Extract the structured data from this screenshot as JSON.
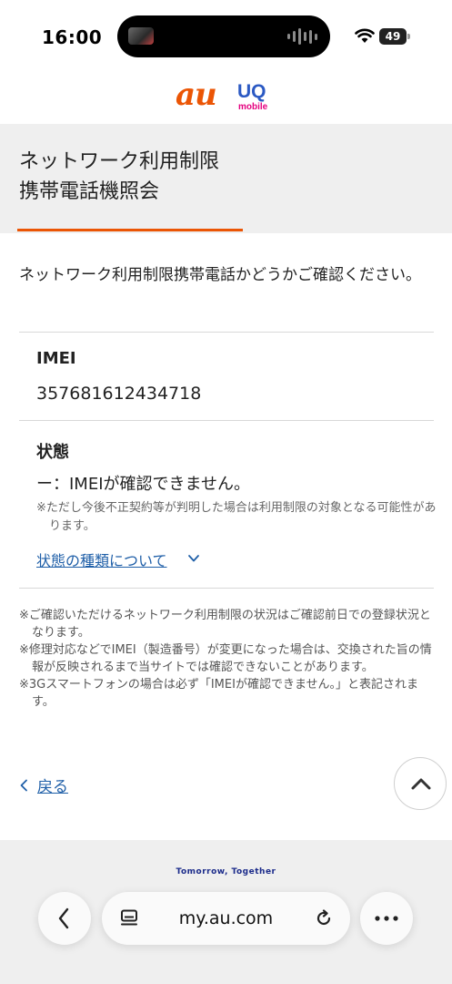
{
  "status_bar": {
    "time": "16:00",
    "battery": "49"
  },
  "logos": {
    "au": "au",
    "uq": "UQ",
    "uq_sub": "mobile"
  },
  "page_title": "ネットワーク利用制限\n携帯電話機照会",
  "intro": "ネットワーク利用制限携帯電話かどうかご確認ください。",
  "imei": {
    "label": "IMEI",
    "value": "357681612434718"
  },
  "status": {
    "label": "状態",
    "value": "ー：IMEIが確認できません。",
    "note": "※ただし今後不正契約等が判明した場合は利用制限の対象となる可能性があります。",
    "link": "状態の種類について"
  },
  "footnotes": [
    "※ご確認いただけるネットワーク利用制限の状況はご確認前日での登録状況となります。",
    "※修理対応などでIMEI（製造番号）が変更になった場合は、交換された旨の情報が反映されるまで当サイトでは確認できないことがあります。",
    "※3Gスマートフォンの場合は必ず「IMEIが確認できません。」と表記されます。"
  ],
  "back_link": "戻る",
  "footer_tagline": "Tomorrow, Together",
  "browser": {
    "url": "my.au.com"
  },
  "colors": {
    "accent": "#eb5505",
    "link": "#1f5fa8",
    "band": "#efefef"
  },
  "icons": [
    "wifi-icon",
    "battery-icon",
    "chevron-down-icon",
    "chevron-left-icon",
    "chevron-up-icon",
    "page-menu-icon",
    "reload-icon",
    "more-icon"
  ]
}
